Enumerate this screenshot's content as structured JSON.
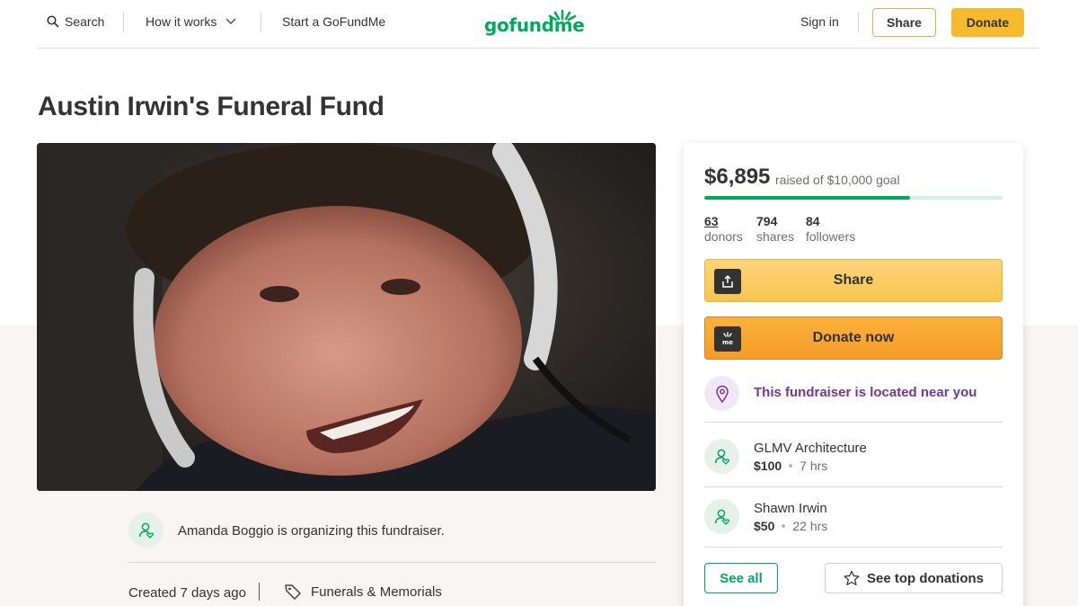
{
  "header": {
    "search_label": "Search",
    "how_it_works_label": "How it works",
    "start_label": "Start a GoFundMe",
    "logo_text": "gofundme",
    "sign_in_label": "Sign in",
    "share_label": "Share",
    "donate_label": "Donate"
  },
  "campaign": {
    "title": "Austin Irwin's Funeral Fund",
    "organizer_text": "Amanda Boggio is organizing this fundraiser.",
    "created_text": "Created 7 days ago",
    "category": "Funerals & Memorials"
  },
  "sidebar": {
    "raised": "$6,895",
    "goal_text": "raised of $10,000 goal",
    "progress_fraction": 0.6895,
    "stats": [
      {
        "value": "63",
        "label": "donors"
      },
      {
        "value": "794",
        "label": "shares"
      },
      {
        "value": "84",
        "label": "followers"
      }
    ],
    "share_button": "Share",
    "donate_button": "Donate now",
    "near_text": "This fundraiser is located near you",
    "donations": [
      {
        "name": "GLMV Architecture",
        "amount": "$100",
        "time": "7 hrs"
      },
      {
        "name": "Shawn Irwin",
        "amount": "$50",
        "time": "22 hrs"
      }
    ],
    "see_all_label": "See all",
    "top_donations_label": "See top donations"
  },
  "colors": {
    "brand_green": "#02a95c",
    "donate_yellow": "#f8ba2d",
    "purple": "#7a3594"
  }
}
